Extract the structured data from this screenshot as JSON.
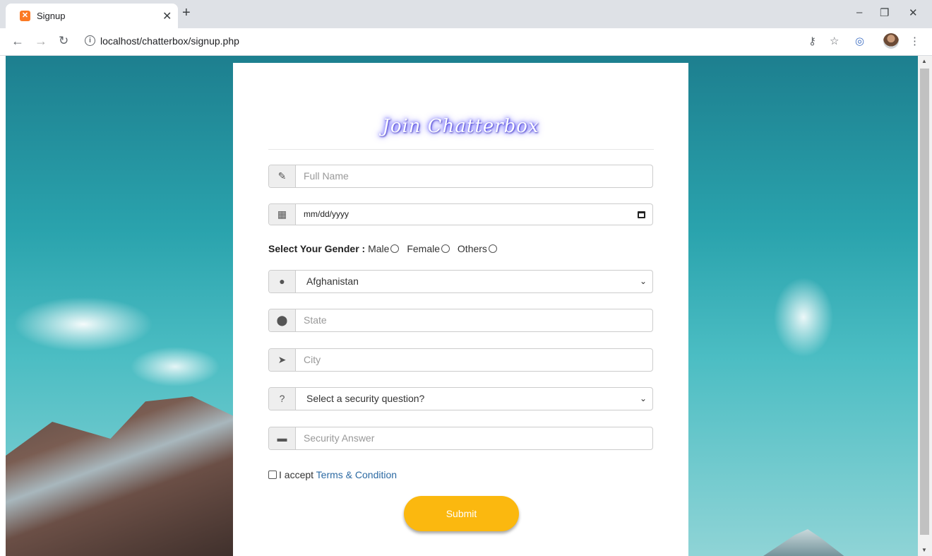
{
  "browser": {
    "tab_title": "Signup",
    "tab_favicon_glyph": "✕",
    "url": "localhost/chatterbox/signup.php",
    "icons": {
      "back": "back-arrow-icon",
      "forward": "forward-arrow-icon",
      "reload": "reload-icon",
      "info": "info-icon",
      "key": "key-icon",
      "star": "star-icon",
      "extension": "extension-icon",
      "profile": "profile-avatar",
      "menu": "menu-icon"
    }
  },
  "form": {
    "title": "Join Chatterbox",
    "full_name_placeholder": "Full Name",
    "dob_placeholder": "mm/dd/yyyy",
    "gender": {
      "label": "Select Your Gender :",
      "options": [
        "Male",
        "Female",
        "Others"
      ]
    },
    "country_value": "Afghanistan",
    "state_placeholder": "State",
    "city_placeholder": "City",
    "security_question_value": "Select a security question?",
    "security_answer_placeholder": "Security Answer",
    "terms": {
      "prefix": "I accept",
      "link": "Terms & Condition"
    },
    "submit_label": "Submit"
  },
  "colors": {
    "submit_bg": "#fbb80f",
    "link": "#2c6aa3",
    "title_glow": "#5b53ff"
  }
}
